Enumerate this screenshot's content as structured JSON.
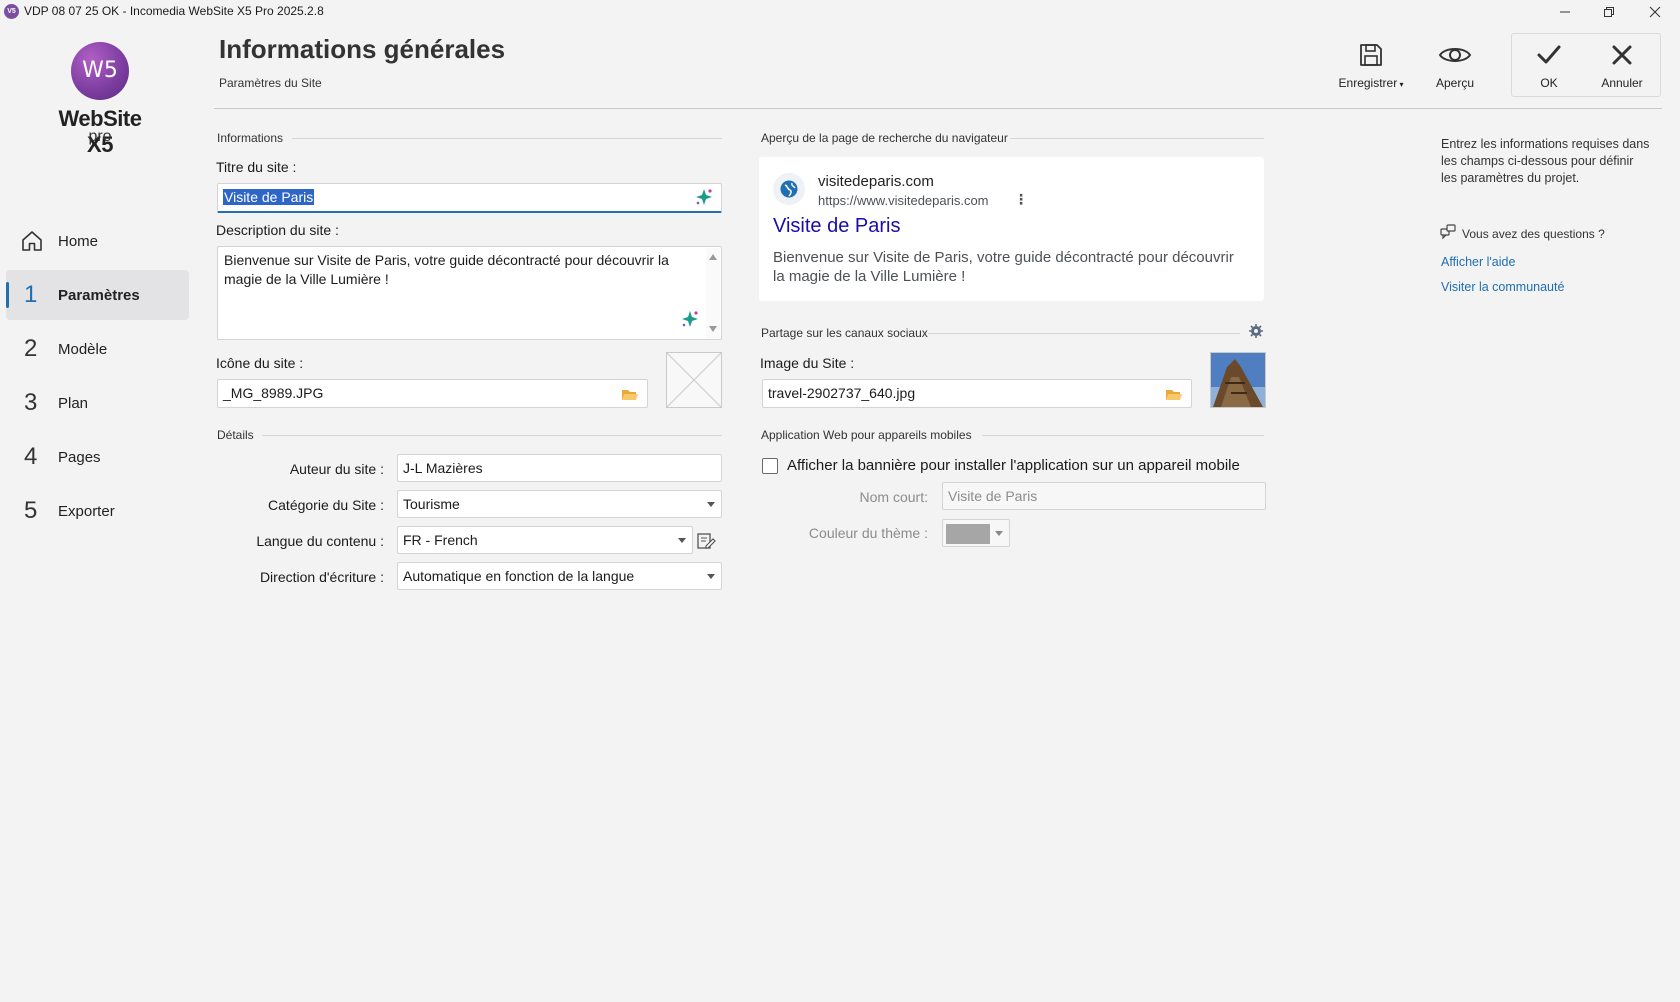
{
  "window": {
    "app_icon": "V5",
    "title": "VDP 08 07 25  OK - Incomedia WebSite X5 Pro 2025.2.8"
  },
  "logo": {
    "mark": "W5",
    "brand": "WebSite X5",
    "edition": "pro"
  },
  "sidebar": {
    "items": [
      {
        "num": "",
        "label": "Home",
        "icon": "home-icon"
      },
      {
        "num": "1",
        "label": "Paramètres",
        "active": true
      },
      {
        "num": "2",
        "label": "Modèle"
      },
      {
        "num": "3",
        "label": "Plan"
      },
      {
        "num": "4",
        "label": "Pages"
      },
      {
        "num": "5",
        "label": "Exporter"
      }
    ]
  },
  "header": {
    "title": "Informations générales",
    "subtitle": "Paramètres du Site",
    "toolbar": {
      "save_label": "Enregistrer",
      "preview_label": "Aperçu",
      "ok_label": "OK",
      "cancel_label": "Annuler"
    }
  },
  "informations": {
    "section_title": "Informations",
    "site_title_label": "Titre du site :",
    "site_title_value": "Visite de Paris",
    "description_label": "Description du site :",
    "description_value": "Bienvenue sur Visite de Paris, votre guide décontracté pour découvrir la magie de la Ville Lumière !",
    "icon_label": "Icône du site :",
    "icon_value": "_MG_8989.JPG"
  },
  "details": {
    "section_title": "Détails",
    "author_label": "Auteur du site :",
    "author_value": "J-L Mazières",
    "category_label": "Catégorie du Site :",
    "category_value": "Tourisme",
    "language_label": "Langue du contenu :",
    "language_value": "FR - French",
    "direction_label": "Direction d'écriture :",
    "direction_value": "Automatique en fonction de la langue"
  },
  "search_preview": {
    "section_title": "Aperçu de la page de recherche du navigateur",
    "site_name": "visitedeparis.com",
    "url": "https://www.visitedeparis.com",
    "title": "Visite de Paris",
    "description": "Bienvenue sur Visite de Paris, votre guide décontracté pour découvrir la magie de la Ville Lumière !"
  },
  "social": {
    "section_title": "Partage sur les canaux sociaux",
    "image_label": "Image du Site :",
    "image_value": "travel-2902737_640.jpg"
  },
  "mobile_app": {
    "section_title": "Application Web pour appareils mobiles",
    "banner_checkbox_label": "Afficher la bannière pour installer l'application sur un appareil mobile",
    "banner_checked": false,
    "short_name_label": "Nom court:",
    "short_name_value": "Visite de Paris",
    "theme_color_label": "Couleur du thème :",
    "theme_color": "#a6a6a6"
  },
  "help": {
    "intro": "Entrez les informations requises dans les champs ci-dessous pour définir les paramètres du projet.",
    "question": "Vous avez des questions ?",
    "link_help": "Afficher l'aide",
    "link_community": "Visiter la communauté"
  },
  "colors": {
    "accent": "#1f6fb2",
    "serp_title": "#1a0dab",
    "background": "#f3f3f3",
    "brand_purple": "#7a3c9e"
  }
}
